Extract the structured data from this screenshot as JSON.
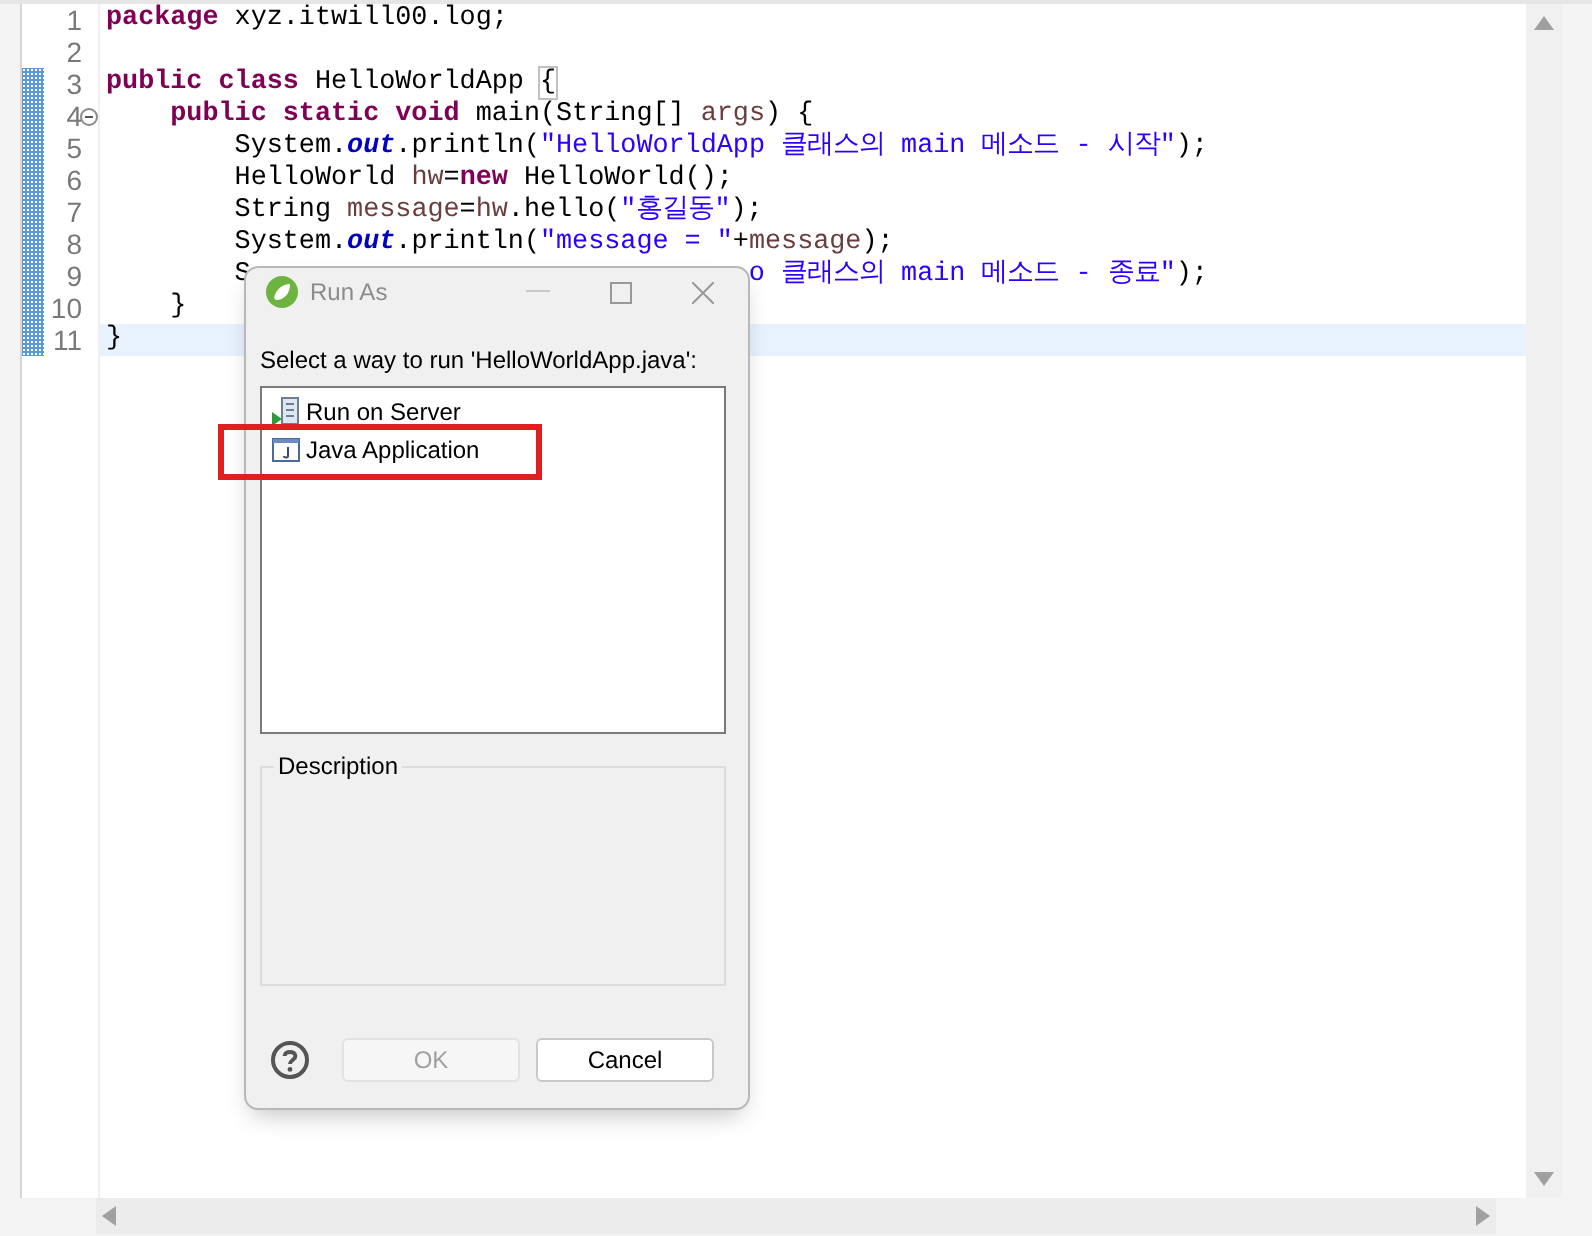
{
  "editor": {
    "lines": [
      {
        "number": "1",
        "changed": false,
        "current": false,
        "foldable": false,
        "segments": [
          {
            "kind": "keyword",
            "text": "package"
          },
          {
            "kind": "plain",
            "text": " xyz.itwill00.log;"
          }
        ]
      },
      {
        "number": "2",
        "changed": false,
        "current": false,
        "foldable": false
      },
      {
        "number": "3",
        "changed": true,
        "current": false,
        "foldable": false,
        "segments": [
          {
            "kind": "keyword",
            "text": "public class"
          },
          {
            "kind": "plain",
            "text": " HelloWorldApp "
          },
          {
            "kind": "bracket",
            "text": "{"
          }
        ]
      },
      {
        "number": "4",
        "changed": true,
        "current": false,
        "foldable": true,
        "segments": [
          {
            "kind": "keyword",
            "text": "    public static void"
          },
          {
            "kind": "plain",
            "text": " main(String[] "
          },
          {
            "kind": "variable",
            "text": "args"
          },
          {
            "kind": "plain",
            "text": ") {"
          }
        ]
      },
      {
        "number": "5",
        "changed": true,
        "current": false,
        "foldable": false,
        "segments": [
          {
            "kind": "plain",
            "text": "        System."
          },
          {
            "kind": "field",
            "text": "out"
          },
          {
            "kind": "plain",
            "text": ".println("
          },
          {
            "kind": "string",
            "text": "\"HelloWorldApp 클래스의 main 메소드 - 시작\""
          },
          {
            "kind": "plain",
            "text": ");"
          }
        ]
      },
      {
        "number": "6",
        "changed": true,
        "current": false,
        "foldable": false,
        "segments": [
          {
            "kind": "plain",
            "text": "        HelloWorld "
          },
          {
            "kind": "variable",
            "text": "hw"
          },
          {
            "kind": "plain",
            "text": "="
          },
          {
            "kind": "keyword",
            "text": "new"
          },
          {
            "kind": "plain",
            "text": " HelloWorld();"
          }
        ]
      },
      {
        "number": "7",
        "changed": true,
        "current": false,
        "foldable": false,
        "segments": [
          {
            "kind": "plain",
            "text": "        String "
          },
          {
            "kind": "variable",
            "text": "message"
          },
          {
            "kind": "plain",
            "text": "="
          },
          {
            "kind": "variable",
            "text": "hw"
          },
          {
            "kind": "plain",
            "text": ".hello("
          },
          {
            "kind": "string",
            "text": "\"홍길동\""
          },
          {
            "kind": "plain",
            "text": ");"
          }
        ]
      },
      {
        "number": "8",
        "changed": true,
        "current": false,
        "foldable": false,
        "segments": [
          {
            "kind": "plain",
            "text": "        System."
          },
          {
            "kind": "field",
            "text": "out"
          },
          {
            "kind": "plain",
            "text": ".println("
          },
          {
            "kind": "string",
            "text": "\"message = \""
          },
          {
            "kind": "plain",
            "text": "+"
          },
          {
            "kind": "variable",
            "text": "message"
          },
          {
            "kind": "plain",
            "text": ");"
          }
        ]
      },
      {
        "number": "9",
        "changed": true,
        "current": false,
        "foldable": false,
        "segments": [
          {
            "kind": "plain",
            "text": "        S"
          },
          {
            "kind": "gap"
          },
          {
            "kind": "string",
            "text": "o 클래스의 main 메소드 - 종료\""
          },
          {
            "kind": "plain",
            "text": ");"
          }
        ]
      },
      {
        "number": "10",
        "changed": true,
        "current": false,
        "foldable": false,
        "segments": [
          {
            "kind": "plain",
            "text": "    }"
          }
        ]
      },
      {
        "number": "11",
        "changed": true,
        "current": true,
        "foldable": false,
        "segments": [
          {
            "kind": "plain",
            "text": "}"
          }
        ]
      }
    ]
  },
  "dialog": {
    "title": "Run As",
    "prompt": "Select a way to run 'HelloWorldApp.java':",
    "items": [
      {
        "kind": "server",
        "label": "Run on Server",
        "selected": false,
        "highlighted": false
      },
      {
        "kind": "java",
        "label": "Java Application",
        "selected": false,
        "highlighted": true
      }
    ],
    "description": {
      "label": "Description"
    },
    "buttons": [
      {
        "label": "OK",
        "disabled": true
      },
      {
        "label": "Cancel",
        "disabled": false
      }
    ]
  }
}
